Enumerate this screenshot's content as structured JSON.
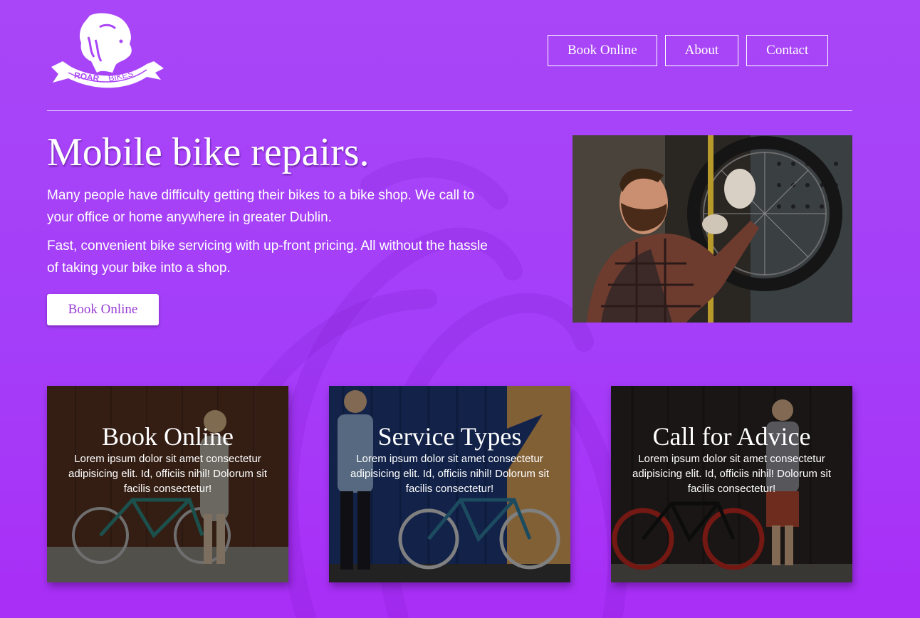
{
  "brand": {
    "logo_text_primary": "ROAR",
    "logo_text_secondary": "BIKES"
  },
  "nav": {
    "items": [
      {
        "label": "Book Online"
      },
      {
        "label": "About"
      },
      {
        "label": "Contact"
      }
    ]
  },
  "hero": {
    "title": "Mobile bike repairs.",
    "paragraphs": [
      "Many people have difficulty getting their bikes to a bike shop. We call to your office or home anywhere in greater Dublin.",
      "Fast, convenient bike servicing with up-front pricing. All without the hassle of taking your bike into a shop."
    ],
    "cta_label": "Book Online"
  },
  "cards": [
    {
      "title": "Book Online",
      "text": "Lorem ipsum dolor sit amet consectetur adipisicing elit. Id, officiis nihil! Dolorum sit facilis consectetur!"
    },
    {
      "title": "Service Types",
      "text": "Lorem ipsum dolor sit amet consectetur adipisicing elit. Id, officiis nihil! Dolorum sit facilis consectetur!"
    },
    {
      "title": "Call for Advice",
      "text": "Lorem ipsum dolor sit amet consectetur adipisicing elit. Id, officiis nihil! Dolorum sit facilis consectetur!"
    }
  ],
  "colors": {
    "background": "#a43ef9",
    "accent": "#9a3ed6",
    "text": "#ffffff"
  }
}
